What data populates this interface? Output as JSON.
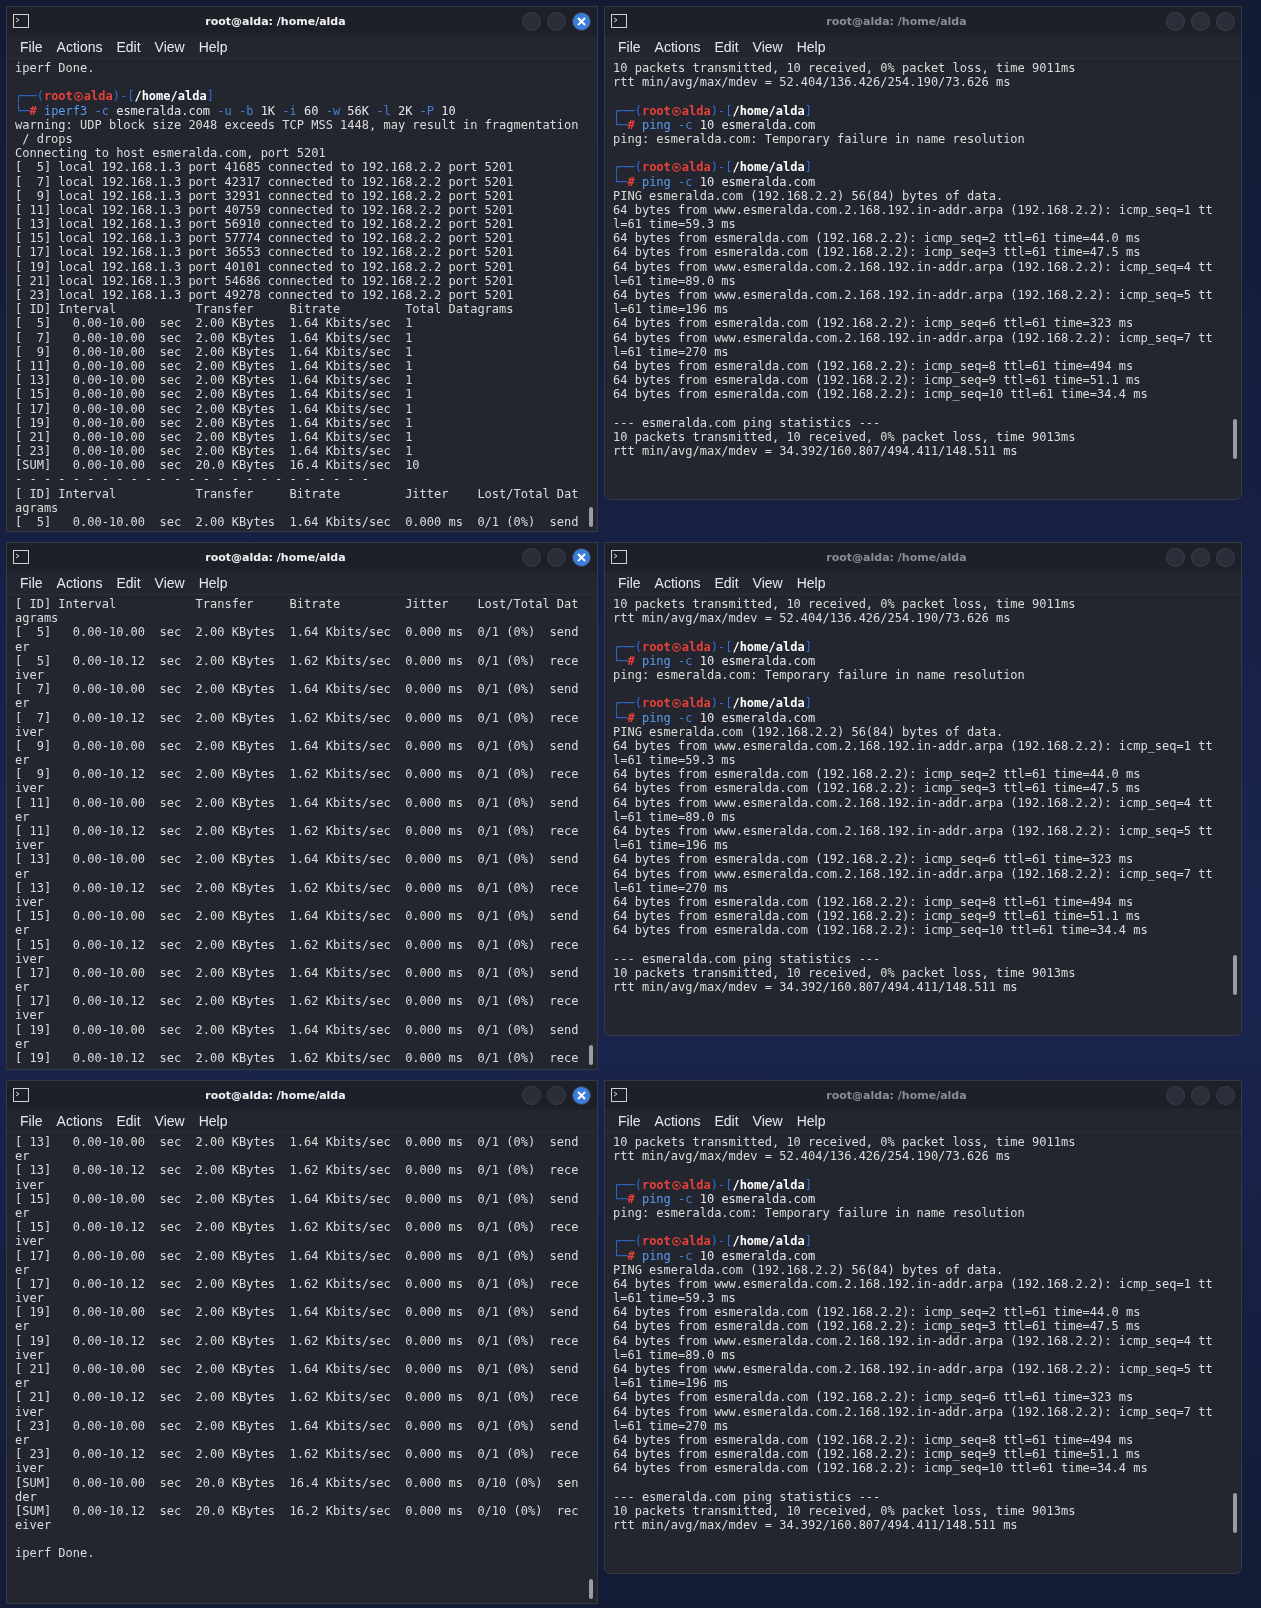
{
  "windows": [
    {
      "title": "root@alda: /home/alda",
      "active": true,
      "menu": [
        "File",
        "Actions",
        "Edit",
        "View",
        "Help"
      ],
      "lines": [
        {
          "kind": "plain",
          "text": "iperf Done."
        },
        {
          "kind": "blank"
        },
        {
          "kind": "prompt",
          "open": "┌──(",
          "user": "root",
          "host": "alda",
          "mid": ")-[",
          "path": "/home/alda",
          "close": "]"
        },
        {
          "kind": "command",
          "corner": "└─",
          "hash": "#",
          "words": [
            {
              "text": "iperf3",
              "kind": "program"
            },
            {
              "text": "-c",
              "kind": "flag"
            },
            {
              "text": "esmeralda.com",
              "kind": "value"
            },
            {
              "text": "-u",
              "kind": "flag"
            },
            {
              "text": "-b",
              "kind": "flag"
            },
            {
              "text": "1K",
              "kind": "value"
            },
            {
              "text": "-i",
              "kind": "flag"
            },
            {
              "text": "60",
              "kind": "value"
            },
            {
              "text": "-w",
              "kind": "flag"
            },
            {
              "text": "56K",
              "kind": "value"
            },
            {
              "text": "-l",
              "kind": "flag"
            },
            {
              "text": "2K",
              "kind": "value"
            },
            {
              "text": "-P",
              "kind": "flag"
            },
            {
              "text": "10",
              "kind": "value"
            }
          ]
        },
        {
          "kind": "plain",
          "text": "warning: UDP block size 2048 exceeds TCP MSS 1448, may result in fragmentation"
        },
        {
          "kind": "plain",
          "text": " / drops"
        },
        {
          "kind": "plain",
          "text": "Connecting to host esmeralda.com, port 5201"
        },
        {
          "kind": "plain",
          "text": "[  5] local 192.168.1.3 port 41685 connected to 192.168.2.2 port 5201"
        },
        {
          "kind": "plain",
          "text": "[  7] local 192.168.1.3 port 42317 connected to 192.168.2.2 port 5201"
        },
        {
          "kind": "plain",
          "text": "[  9] local 192.168.1.3 port 32931 connected to 192.168.2.2 port 5201"
        },
        {
          "kind": "plain",
          "text": "[ 11] local 192.168.1.3 port 40759 connected to 192.168.2.2 port 5201"
        },
        {
          "kind": "plain",
          "text": "[ 13] local 192.168.1.3 port 56910 connected to 192.168.2.2 port 5201"
        },
        {
          "kind": "plain",
          "text": "[ 15] local 192.168.1.3 port 57774 connected to 192.168.2.2 port 5201"
        },
        {
          "kind": "plain",
          "text": "[ 17] local 192.168.1.3 port 36553 connected to 192.168.2.2 port 5201"
        },
        {
          "kind": "plain",
          "text": "[ 19] local 192.168.1.3 port 40101 connected to 192.168.2.2 port 5201"
        },
        {
          "kind": "plain",
          "text": "[ 21] local 192.168.1.3 port 54686 connected to 192.168.2.2 port 5201"
        },
        {
          "kind": "plain",
          "text": "[ 23] local 192.168.1.3 port 49278 connected to 192.168.2.2 port 5201"
        },
        {
          "kind": "plain",
          "text": "[ ID] Interval           Transfer     Bitrate         Total Datagrams"
        },
        {
          "kind": "plain",
          "text": "[  5]   0.00-10.00  sec  2.00 KBytes  1.64 Kbits/sec  1"
        },
        {
          "kind": "plain",
          "text": "[  7]   0.00-10.00  sec  2.00 KBytes  1.64 Kbits/sec  1"
        },
        {
          "kind": "plain",
          "text": "[  9]   0.00-10.00  sec  2.00 KBytes  1.64 Kbits/sec  1"
        },
        {
          "kind": "plain",
          "text": "[ 11]   0.00-10.00  sec  2.00 KBytes  1.64 Kbits/sec  1"
        },
        {
          "kind": "plain",
          "text": "[ 13]   0.00-10.00  sec  2.00 KBytes  1.64 Kbits/sec  1"
        },
        {
          "kind": "plain",
          "text": "[ 15]   0.00-10.00  sec  2.00 KBytes  1.64 Kbits/sec  1"
        },
        {
          "kind": "plain",
          "text": "[ 17]   0.00-10.00  sec  2.00 KBytes  1.64 Kbits/sec  1"
        },
        {
          "kind": "plain",
          "text": "[ 19]   0.00-10.00  sec  2.00 KBytes  1.64 Kbits/sec  1"
        },
        {
          "kind": "plain",
          "text": "[ 21]   0.00-10.00  sec  2.00 KBytes  1.64 Kbits/sec  1"
        },
        {
          "kind": "plain",
          "text": "[ 23]   0.00-10.00  sec  2.00 KBytes  1.64 Kbits/sec  1"
        },
        {
          "kind": "plain",
          "text": "[SUM]   0.00-10.00  sec  20.0 KBytes  16.4 Kbits/sec  10"
        },
        {
          "kind": "plain",
          "text": "- - - - - - - - - - - - - - - - - - - - - - - - -"
        },
        {
          "kind": "plain",
          "text": "[ ID] Interval           Transfer     Bitrate         Jitter    Lost/Total Dat"
        },
        {
          "kind": "plain",
          "text": "agrams"
        },
        {
          "kind": "plain",
          "text": "[  5]   0.00-10.00  sec  2.00 KBytes  1.64 Kbits/sec  0.000 ms  0/1 (0%)  send"
        }
      ]
    },
    {
      "title": "root@alda: /home/alda",
      "active": false,
      "menu": [
        "File",
        "Actions",
        "Edit",
        "View",
        "Help"
      ],
      "lines": [
        {
          "kind": "plain",
          "text": "10 packets transmitted, 10 received, 0% packet loss, time 9011ms"
        },
        {
          "kind": "plain",
          "text": "rtt min/avg/max/mdev = 52.404/136.426/254.190/73.626 ms"
        },
        {
          "kind": "blank"
        },
        {
          "kind": "prompt",
          "open": "┌──(",
          "user": "root",
          "host": "alda",
          "mid": ")-[",
          "path": "/home/alda",
          "close": "]"
        },
        {
          "kind": "command",
          "corner": "└─",
          "hash": "#",
          "words": [
            {
              "text": "ping",
              "kind": "program"
            },
            {
              "text": "-c",
              "kind": "flag"
            },
            {
              "text": "10",
              "kind": "value"
            },
            {
              "text": "esmeralda.com",
              "kind": "value"
            }
          ]
        },
        {
          "kind": "plain",
          "text": "ping: esmeralda.com: Temporary failure in name resolution"
        },
        {
          "kind": "blank"
        },
        {
          "kind": "prompt",
          "open": "┌──(",
          "user": "root",
          "host": "alda",
          "mid": ")-[",
          "path": "/home/alda",
          "close": "]"
        },
        {
          "kind": "command",
          "corner": "└─",
          "hash": "#",
          "words": [
            {
              "text": "ping",
              "kind": "program"
            },
            {
              "text": "-c",
              "kind": "flag"
            },
            {
              "text": "10",
              "kind": "value"
            },
            {
              "text": "esmeralda.com",
              "kind": "value"
            }
          ]
        },
        {
          "kind": "plain",
          "text": "PING esmeralda.com (192.168.2.2) 56(84) bytes of data."
        },
        {
          "kind": "plain",
          "text": "64 bytes from www.esmeralda.com.2.168.192.in-addr.arpa (192.168.2.2): icmp_seq=1 tt"
        },
        {
          "kind": "plain",
          "text": "l=61 time=59.3 ms"
        },
        {
          "kind": "plain",
          "text": "64 bytes from esmeralda.com (192.168.2.2): icmp_seq=2 ttl=61 time=44.0 ms"
        },
        {
          "kind": "plain",
          "text": "64 bytes from esmeralda.com (192.168.2.2): icmp_seq=3 ttl=61 time=47.5 ms"
        },
        {
          "kind": "plain",
          "text": "64 bytes from www.esmeralda.com.2.168.192.in-addr.arpa (192.168.2.2): icmp_seq=4 tt"
        },
        {
          "kind": "plain",
          "text": "l=61 time=89.0 ms"
        },
        {
          "kind": "plain",
          "text": "64 bytes from www.esmeralda.com.2.168.192.in-addr.arpa (192.168.2.2): icmp_seq=5 tt"
        },
        {
          "kind": "plain",
          "text": "l=61 time=196 ms"
        },
        {
          "kind": "plain",
          "text": "64 bytes from esmeralda.com (192.168.2.2): icmp_seq=6 ttl=61 time=323 ms"
        },
        {
          "kind": "plain",
          "text": "64 bytes from www.esmeralda.com.2.168.192.in-addr.arpa (192.168.2.2): icmp_seq=7 tt"
        },
        {
          "kind": "plain",
          "text": "l=61 time=270 ms"
        },
        {
          "kind": "plain",
          "text": "64 bytes from esmeralda.com (192.168.2.2): icmp_seq=8 ttl=61 time=494 ms"
        },
        {
          "kind": "plain",
          "text": "64 bytes from esmeralda.com (192.168.2.2): icmp_seq=9 ttl=61 time=51.1 ms"
        },
        {
          "kind": "plain",
          "text": "64 bytes from esmeralda.com (192.168.2.2): icmp_seq=10 ttl=61 time=34.4 ms"
        },
        {
          "kind": "blank"
        },
        {
          "kind": "plain",
          "text": "--- esmeralda.com ping statistics ---"
        },
        {
          "kind": "plain",
          "text": "10 packets transmitted, 10 received, 0% packet loss, time 9013ms"
        },
        {
          "kind": "plain",
          "text": "rtt min/avg/max/mdev = 34.392/160.807/494.411/148.511 ms"
        }
      ]
    },
    {
      "title": "root@alda: /home/alda",
      "active": true,
      "menu": [
        "File",
        "Actions",
        "Edit",
        "View",
        "Help"
      ],
      "lines": [
        {
          "kind": "plain",
          "text": "[ ID] Interval           Transfer     Bitrate         Jitter    Lost/Total Dat"
        },
        {
          "kind": "plain",
          "text": "agrams"
        },
        {
          "kind": "plain",
          "text": "[  5]   0.00-10.00  sec  2.00 KBytes  1.64 Kbits/sec  0.000 ms  0/1 (0%)  send"
        },
        {
          "kind": "plain",
          "text": "er"
        },
        {
          "kind": "plain",
          "text": "[  5]   0.00-10.12  sec  2.00 KBytes  1.62 Kbits/sec  0.000 ms  0/1 (0%)  rece"
        },
        {
          "kind": "plain",
          "text": "iver"
        },
        {
          "kind": "plain",
          "text": "[  7]   0.00-10.00  sec  2.00 KBytes  1.64 Kbits/sec  0.000 ms  0/1 (0%)  send"
        },
        {
          "kind": "plain",
          "text": "er"
        },
        {
          "kind": "plain",
          "text": "[  7]   0.00-10.12  sec  2.00 KBytes  1.62 Kbits/sec  0.000 ms  0/1 (0%)  rece"
        },
        {
          "kind": "plain",
          "text": "iver"
        },
        {
          "kind": "plain",
          "text": "[  9]   0.00-10.00  sec  2.00 KBytes  1.64 Kbits/sec  0.000 ms  0/1 (0%)  send"
        },
        {
          "kind": "plain",
          "text": "er"
        },
        {
          "kind": "plain",
          "text": "[  9]   0.00-10.12  sec  2.00 KBytes  1.62 Kbits/sec  0.000 ms  0/1 (0%)  rece"
        },
        {
          "kind": "plain",
          "text": "iver"
        },
        {
          "kind": "plain",
          "text": "[ 11]   0.00-10.00  sec  2.00 KBytes  1.64 Kbits/sec  0.000 ms  0/1 (0%)  send"
        },
        {
          "kind": "plain",
          "text": "er"
        },
        {
          "kind": "plain",
          "text": "[ 11]   0.00-10.12  sec  2.00 KBytes  1.62 Kbits/sec  0.000 ms  0/1 (0%)  rece"
        },
        {
          "kind": "plain",
          "text": "iver"
        },
        {
          "kind": "plain",
          "text": "[ 13]   0.00-10.00  sec  2.00 KBytes  1.64 Kbits/sec  0.000 ms  0/1 (0%)  send"
        },
        {
          "kind": "plain",
          "text": "er"
        },
        {
          "kind": "plain",
          "text": "[ 13]   0.00-10.12  sec  2.00 KBytes  1.62 Kbits/sec  0.000 ms  0/1 (0%)  rece"
        },
        {
          "kind": "plain",
          "text": "iver"
        },
        {
          "kind": "plain",
          "text": "[ 15]   0.00-10.00  sec  2.00 KBytes  1.64 Kbits/sec  0.000 ms  0/1 (0%)  send"
        },
        {
          "kind": "plain",
          "text": "er"
        },
        {
          "kind": "plain",
          "text": "[ 15]   0.00-10.12  sec  2.00 KBytes  1.62 Kbits/sec  0.000 ms  0/1 (0%)  rece"
        },
        {
          "kind": "plain",
          "text": "iver"
        },
        {
          "kind": "plain",
          "text": "[ 17]   0.00-10.00  sec  2.00 KBytes  1.64 Kbits/sec  0.000 ms  0/1 (0%)  send"
        },
        {
          "kind": "plain",
          "text": "er"
        },
        {
          "kind": "plain",
          "text": "[ 17]   0.00-10.12  sec  2.00 KBytes  1.62 Kbits/sec  0.000 ms  0/1 (0%)  rece"
        },
        {
          "kind": "plain",
          "text": "iver"
        },
        {
          "kind": "plain",
          "text": "[ 19]   0.00-10.00  sec  2.00 KBytes  1.64 Kbits/sec  0.000 ms  0/1 (0%)  send"
        },
        {
          "kind": "plain",
          "text": "er"
        },
        {
          "kind": "plain",
          "text": "[ 19]   0.00-10.12  sec  2.00 KBytes  1.62 Kbits/sec  0.000 ms  0/1 (0%)  rece"
        }
      ]
    },
    {
      "title": "root@alda: /home/alda",
      "active": false,
      "menu": [
        "File",
        "Actions",
        "Edit",
        "View",
        "Help"
      ],
      "lines": [
        {
          "kind": "plain",
          "text": "10 packets transmitted, 10 received, 0% packet loss, time 9011ms"
        },
        {
          "kind": "plain",
          "text": "rtt min/avg/max/mdev = 52.404/136.426/254.190/73.626 ms"
        },
        {
          "kind": "blank"
        },
        {
          "kind": "prompt",
          "open": "┌──(",
          "user": "root",
          "host": "alda",
          "mid": ")-[",
          "path": "/home/alda",
          "close": "]"
        },
        {
          "kind": "command",
          "corner": "└─",
          "hash": "#",
          "words": [
            {
              "text": "ping",
              "kind": "program"
            },
            {
              "text": "-c",
              "kind": "flag"
            },
            {
              "text": "10",
              "kind": "value"
            },
            {
              "text": "esmeralda.com",
              "kind": "value"
            }
          ]
        },
        {
          "kind": "plain",
          "text": "ping: esmeralda.com: Temporary failure in name resolution"
        },
        {
          "kind": "blank"
        },
        {
          "kind": "prompt",
          "open": "┌──(",
          "user": "root",
          "host": "alda",
          "mid": ")-[",
          "path": "/home/alda",
          "close": "]"
        },
        {
          "kind": "command",
          "corner": "└─",
          "hash": "#",
          "words": [
            {
              "text": "ping",
              "kind": "program"
            },
            {
              "text": "-c",
              "kind": "flag"
            },
            {
              "text": "10",
              "kind": "value"
            },
            {
              "text": "esmeralda.com",
              "kind": "value"
            }
          ]
        },
        {
          "kind": "plain",
          "text": "PING esmeralda.com (192.168.2.2) 56(84) bytes of data."
        },
        {
          "kind": "plain",
          "text": "64 bytes from www.esmeralda.com.2.168.192.in-addr.arpa (192.168.2.2): icmp_seq=1 tt"
        },
        {
          "kind": "plain",
          "text": "l=61 time=59.3 ms"
        },
        {
          "kind": "plain",
          "text": "64 bytes from esmeralda.com (192.168.2.2): icmp_seq=2 ttl=61 time=44.0 ms"
        },
        {
          "kind": "plain",
          "text": "64 bytes from esmeralda.com (192.168.2.2): icmp_seq=3 ttl=61 time=47.5 ms"
        },
        {
          "kind": "plain",
          "text": "64 bytes from www.esmeralda.com.2.168.192.in-addr.arpa (192.168.2.2): icmp_seq=4 tt"
        },
        {
          "kind": "plain",
          "text": "l=61 time=89.0 ms"
        },
        {
          "kind": "plain",
          "text": "64 bytes from www.esmeralda.com.2.168.192.in-addr.arpa (192.168.2.2): icmp_seq=5 tt"
        },
        {
          "kind": "plain",
          "text": "l=61 time=196 ms"
        },
        {
          "kind": "plain",
          "text": "64 bytes from esmeralda.com (192.168.2.2): icmp_seq=6 ttl=61 time=323 ms"
        },
        {
          "kind": "plain",
          "text": "64 bytes from www.esmeralda.com.2.168.192.in-addr.arpa (192.168.2.2): icmp_seq=7 tt"
        },
        {
          "kind": "plain",
          "text": "l=61 time=270 ms"
        },
        {
          "kind": "plain",
          "text": "64 bytes from esmeralda.com (192.168.2.2): icmp_seq=8 ttl=61 time=494 ms"
        },
        {
          "kind": "plain",
          "text": "64 bytes from esmeralda.com (192.168.2.2): icmp_seq=9 ttl=61 time=51.1 ms"
        },
        {
          "kind": "plain",
          "text": "64 bytes from esmeralda.com (192.168.2.2): icmp_seq=10 ttl=61 time=34.4 ms"
        },
        {
          "kind": "blank"
        },
        {
          "kind": "plain",
          "text": "--- esmeralda.com ping statistics ---"
        },
        {
          "kind": "plain",
          "text": "10 packets transmitted, 10 received, 0% packet loss, time 9013ms"
        },
        {
          "kind": "plain",
          "text": "rtt min/avg/max/mdev = 34.392/160.807/494.411/148.511 ms"
        }
      ]
    },
    {
      "title": "root@alda: /home/alda",
      "active": true,
      "menu": [
        "File",
        "Actions",
        "Edit",
        "View",
        "Help"
      ],
      "lines": [
        {
          "kind": "plain",
          "text": "[ 13]   0.00-10.00  sec  2.00 KBytes  1.64 Kbits/sec  0.000 ms  0/1 (0%)  send"
        },
        {
          "kind": "plain",
          "text": "er"
        },
        {
          "kind": "plain",
          "text": "[ 13]   0.00-10.12  sec  2.00 KBytes  1.62 Kbits/sec  0.000 ms  0/1 (0%)  rece"
        },
        {
          "kind": "plain",
          "text": "iver"
        },
        {
          "kind": "plain",
          "text": "[ 15]   0.00-10.00  sec  2.00 KBytes  1.64 Kbits/sec  0.000 ms  0/1 (0%)  send"
        },
        {
          "kind": "plain",
          "text": "er"
        },
        {
          "kind": "plain",
          "text": "[ 15]   0.00-10.12  sec  2.00 KBytes  1.62 Kbits/sec  0.000 ms  0/1 (0%)  rece"
        },
        {
          "kind": "plain",
          "text": "iver"
        },
        {
          "kind": "plain",
          "text": "[ 17]   0.00-10.00  sec  2.00 KBytes  1.64 Kbits/sec  0.000 ms  0/1 (0%)  send"
        },
        {
          "kind": "plain",
          "text": "er"
        },
        {
          "kind": "plain",
          "text": "[ 17]   0.00-10.12  sec  2.00 KBytes  1.62 Kbits/sec  0.000 ms  0/1 (0%)  rece"
        },
        {
          "kind": "plain",
          "text": "iver"
        },
        {
          "kind": "plain",
          "text": "[ 19]   0.00-10.00  sec  2.00 KBytes  1.64 Kbits/sec  0.000 ms  0/1 (0%)  send"
        },
        {
          "kind": "plain",
          "text": "er"
        },
        {
          "kind": "plain",
          "text": "[ 19]   0.00-10.12  sec  2.00 KBytes  1.62 Kbits/sec  0.000 ms  0/1 (0%)  rece"
        },
        {
          "kind": "plain",
          "text": "iver"
        },
        {
          "kind": "plain",
          "text": "[ 21]   0.00-10.00  sec  2.00 KBytes  1.64 Kbits/sec  0.000 ms  0/1 (0%)  send"
        },
        {
          "kind": "plain",
          "text": "er"
        },
        {
          "kind": "plain",
          "text": "[ 21]   0.00-10.12  sec  2.00 KBytes  1.62 Kbits/sec  0.000 ms  0/1 (0%)  rece"
        },
        {
          "kind": "plain",
          "text": "iver"
        },
        {
          "kind": "plain",
          "text": "[ 23]   0.00-10.00  sec  2.00 KBytes  1.64 Kbits/sec  0.000 ms  0/1 (0%)  send"
        },
        {
          "kind": "plain",
          "text": "er"
        },
        {
          "kind": "plain",
          "text": "[ 23]   0.00-10.12  sec  2.00 KBytes  1.62 Kbits/sec  0.000 ms  0/1 (0%)  rece"
        },
        {
          "kind": "plain",
          "text": "iver"
        },
        {
          "kind": "plain",
          "text": "[SUM]   0.00-10.00  sec  20.0 KBytes  16.4 Kbits/sec  0.000 ms  0/10 (0%)  sen"
        },
        {
          "kind": "plain",
          "text": "der"
        },
        {
          "kind": "plain",
          "text": "[SUM]   0.00-10.12  sec  20.0 KBytes  16.2 Kbits/sec  0.000 ms  0/10 (0%)  rec"
        },
        {
          "kind": "plain",
          "text": "eiver"
        },
        {
          "kind": "blank"
        },
        {
          "kind": "plain",
          "text": "iperf Done."
        }
      ]
    },
    {
      "title": "root@alda: /home/alda",
      "active": false,
      "menu": [
        "File",
        "Actions",
        "Edit",
        "View",
        "Help"
      ],
      "lines": [
        {
          "kind": "plain",
          "text": "10 packets transmitted, 10 received, 0% packet loss, time 9011ms"
        },
        {
          "kind": "plain",
          "text": "rtt min/avg/max/mdev = 52.404/136.426/254.190/73.626 ms"
        },
        {
          "kind": "blank"
        },
        {
          "kind": "prompt",
          "open": "┌──(",
          "user": "root",
          "host": "alda",
          "mid": ")-[",
          "path": "/home/alda",
          "close": "]"
        },
        {
          "kind": "command",
          "corner": "└─",
          "hash": "#",
          "words": [
            {
              "text": "ping",
              "kind": "program"
            },
            {
              "text": "-c",
              "kind": "flag"
            },
            {
              "text": "10",
              "kind": "value"
            },
            {
              "text": "esmeralda.com",
              "kind": "value"
            }
          ]
        },
        {
          "kind": "plain",
          "text": "ping: esmeralda.com: Temporary failure in name resolution"
        },
        {
          "kind": "blank"
        },
        {
          "kind": "prompt",
          "open": "┌──(",
          "user": "root",
          "host": "alda",
          "mid": ")-[",
          "path": "/home/alda",
          "close": "]"
        },
        {
          "kind": "command",
          "corner": "└─",
          "hash": "#",
          "words": [
            {
              "text": "ping",
              "kind": "program"
            },
            {
              "text": "-c",
              "kind": "flag"
            },
            {
              "text": "10",
              "kind": "value"
            },
            {
              "text": "esmeralda.com",
              "kind": "value"
            }
          ]
        },
        {
          "kind": "plain",
          "text": "PING esmeralda.com (192.168.2.2) 56(84) bytes of data."
        },
        {
          "kind": "plain",
          "text": "64 bytes from www.esmeralda.com.2.168.192.in-addr.arpa (192.168.2.2): icmp_seq=1 tt"
        },
        {
          "kind": "plain",
          "text": "l=61 time=59.3 ms"
        },
        {
          "kind": "plain",
          "text": "64 bytes from esmeralda.com (192.168.2.2): icmp_seq=2 ttl=61 time=44.0 ms"
        },
        {
          "kind": "plain",
          "text": "64 bytes from esmeralda.com (192.168.2.2): icmp_seq=3 ttl=61 time=47.5 ms"
        },
        {
          "kind": "plain",
          "text": "64 bytes from www.esmeralda.com.2.168.192.in-addr.arpa (192.168.2.2): icmp_seq=4 tt"
        },
        {
          "kind": "plain",
          "text": "l=61 time=89.0 ms"
        },
        {
          "kind": "plain",
          "text": "64 bytes from www.esmeralda.com.2.168.192.in-addr.arpa (192.168.2.2): icmp_seq=5 tt"
        },
        {
          "kind": "plain",
          "text": "l=61 time=196 ms"
        },
        {
          "kind": "plain",
          "text": "64 bytes from esmeralda.com (192.168.2.2): icmp_seq=6 ttl=61 time=323 ms"
        },
        {
          "kind": "plain",
          "text": "64 bytes from www.esmeralda.com.2.168.192.in-addr.arpa (192.168.2.2): icmp_seq=7 tt"
        },
        {
          "kind": "plain",
          "text": "l=61 time=270 ms"
        },
        {
          "kind": "plain",
          "text": "64 bytes from esmeralda.com (192.168.2.2): icmp_seq=8 ttl=61 time=494 ms"
        },
        {
          "kind": "plain",
          "text": "64 bytes from esmeralda.com (192.168.2.2): icmp_seq=9 ttl=61 time=51.1 ms"
        },
        {
          "kind": "plain",
          "text": "64 bytes from esmeralda.com (192.168.2.2): icmp_seq=10 ttl=61 time=34.4 ms"
        },
        {
          "kind": "blank"
        },
        {
          "kind": "plain",
          "text": "--- esmeralda.com ping statistics ---"
        },
        {
          "kind": "plain",
          "text": "10 packets transmitted, 10 received, 0% packet loss, time 9013ms"
        },
        {
          "kind": "plain",
          "text": "rtt min/avg/max/mdev = 34.392/160.807/494.411/148.511 ms"
        }
      ]
    }
  ]
}
